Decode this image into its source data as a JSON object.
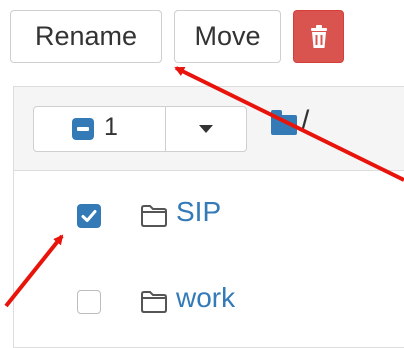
{
  "toolbar": {
    "rename_label": "Rename",
    "move_label": "Move",
    "delete_icon": "trash-icon",
    "delete_color": "#d9534f"
  },
  "list_header": {
    "selected_count": "1",
    "breadcrumb_separator": "/"
  },
  "items": [
    {
      "name": "SIP",
      "checked": true,
      "icon": "folder-icon"
    },
    {
      "name": "work",
      "checked": false,
      "icon": "folder-icon"
    }
  ],
  "colors": {
    "accent": "#337ab7",
    "annotation_arrow": "#e8140b"
  }
}
